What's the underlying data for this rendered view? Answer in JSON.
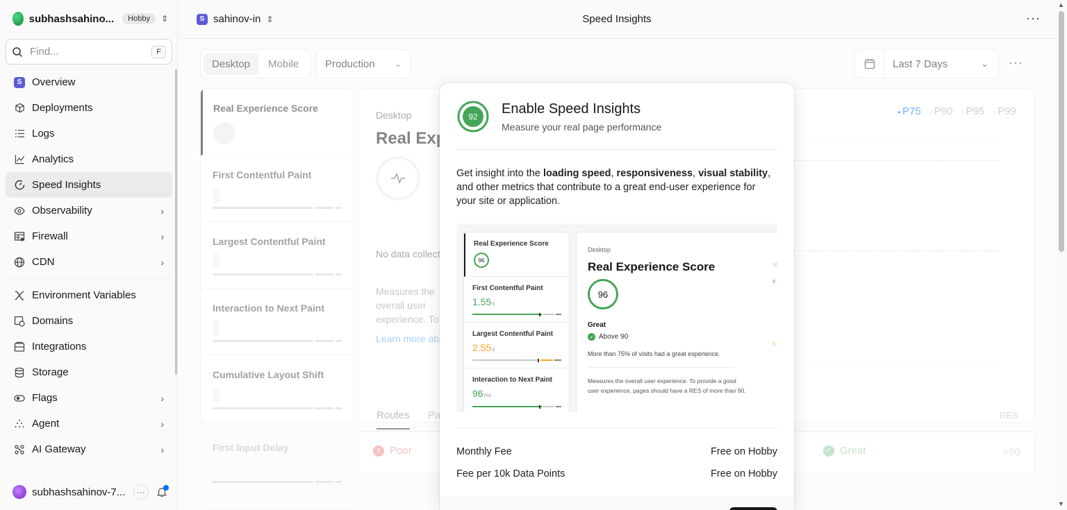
{
  "sidebar": {
    "team_name": "subhashsahino...",
    "plan_badge": "Hobby",
    "search_placeholder": "Find...",
    "search_shortcut": "F",
    "nav_items": [
      {
        "label": "Overview",
        "icon": "project-icon"
      },
      {
        "label": "Deployments",
        "icon": "cube-icon"
      },
      {
        "label": "Logs",
        "icon": "list-icon"
      },
      {
        "label": "Analytics",
        "icon": "chart-icon"
      },
      {
        "label": "Speed Insights",
        "icon": "gauge-icon",
        "active": true
      },
      {
        "label": "Observability",
        "icon": "eye-icon",
        "has_submenu": true
      },
      {
        "label": "Firewall",
        "icon": "firewall-icon",
        "has_submenu": true
      },
      {
        "label": "CDN",
        "icon": "globe-icon",
        "has_submenu": true
      },
      {
        "label": "Environment Variables",
        "icon": "variable-icon"
      },
      {
        "label": "Domains",
        "icon": "domain-icon"
      },
      {
        "label": "Integrations",
        "icon": "integrations-icon"
      },
      {
        "label": "Storage",
        "icon": "database-icon"
      },
      {
        "label": "Flags",
        "icon": "toggle-icon",
        "has_submenu": true
      },
      {
        "label": "Agent",
        "icon": "sparkle-icon",
        "has_submenu": true
      },
      {
        "label": "AI Gateway",
        "icon": "gateway-icon",
        "has_submenu": true
      }
    ],
    "user_name": "subhashsahinov-7..."
  },
  "topbar": {
    "project_name": "sahinov-in",
    "project_initial": "S",
    "page_title": "Speed Insights"
  },
  "controls": {
    "device_tabs": [
      "Desktop",
      "Mobile"
    ],
    "selected_device": "Desktop",
    "environment": "Production",
    "date_range": "Last 7 Days"
  },
  "metrics_list": [
    {
      "label": "Real Experience Score",
      "selected": true
    },
    {
      "label": "First Contentful Paint"
    },
    {
      "label": "Largest Contentful Paint"
    },
    {
      "label": "Interaction to Next Paint"
    },
    {
      "label": "Cumulative Layout Shift"
    }
  ],
  "extra_metric": "First Input Delay",
  "main": {
    "device": "Desktop",
    "title": "Real Experience Score",
    "no_data": "No data collected",
    "description": "Measures the overall user experience. To provide a good user experience, pages should have a RES of more than 90.",
    "learn_more": "Learn more about",
    "percentiles": [
      "P75",
      "P90",
      "P95",
      "P99"
    ],
    "selected_percentile": "P75",
    "tabs": [
      "Routes",
      "Paths"
    ],
    "res_column": "RES",
    "poor_label": "Poor",
    "great_label": "Great",
    "great_threshold": ">90"
  },
  "modal": {
    "score": "92",
    "title": "Enable Speed Insights",
    "subtitle": "Measure your real page performance",
    "para_prefix": "Get insight into the ",
    "para_bold_1": "loading speed",
    "para_sep_1": ", ",
    "para_bold_2": "responsiveness",
    "para_sep_2": ", ",
    "para_bold_3": "visual stability",
    "para_suffix": ", and other metrics that contribute to a great end-user experience for your site or application.",
    "preview": {
      "metrics": [
        {
          "label": "Real Experience Score",
          "value": "96"
        },
        {
          "label": "First Contentful Paint",
          "value": "1.55",
          "unit": "s"
        },
        {
          "label": "Largest Contentful Paint",
          "value": "2.55",
          "unit": "s"
        },
        {
          "label": "Interaction to Next Paint",
          "value": "96",
          "unit": "ms"
        }
      ],
      "device": "Desktop",
      "title": "Real Experience Score",
      "score": "96",
      "rating": "Great",
      "threshold": "Above 90",
      "visits_note": "More than 75% of visits had a great experience.",
      "description": "Measures the overall user experience. To provide a good user experience, pages should have a RES of more than 90.",
      "axis_labels": [
        "10",
        "9",
        "5"
      ]
    },
    "fees": [
      {
        "label": "Monthly Fee",
        "value": "Free on Hobby"
      },
      {
        "label": "Fee per 10k Data Points",
        "value": "Free on Hobby"
      }
    ],
    "colors": {
      "good": "#45a557",
      "warn": "#f5a623",
      "accent": "#0070f3"
    }
  }
}
